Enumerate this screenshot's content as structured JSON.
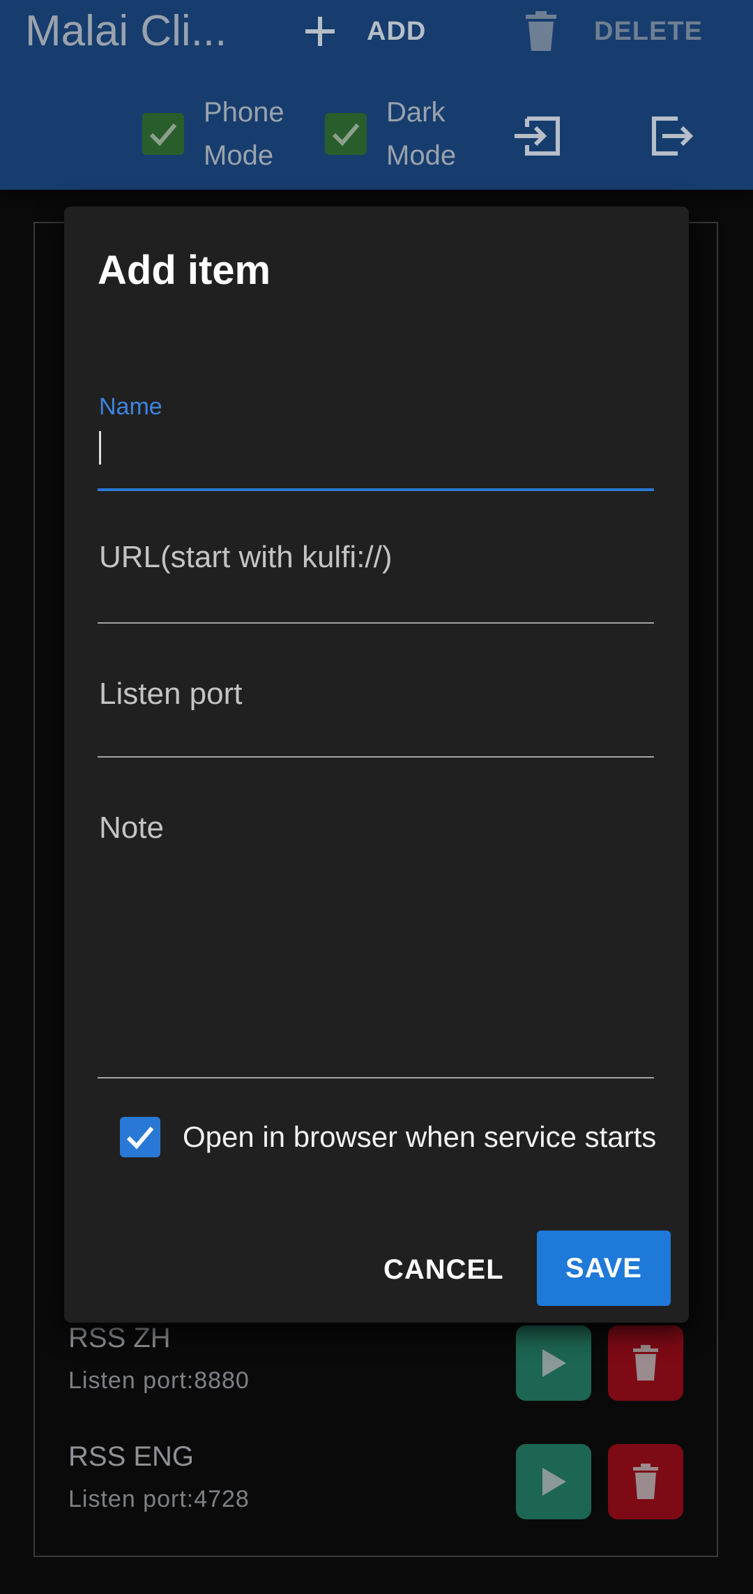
{
  "appbar": {
    "title": "Malai Cli...",
    "add_label": "ADD",
    "delete_label": "DELETE",
    "phone_mode_label": "Phone Mode",
    "dark_mode_label": "Dark Mode",
    "phone_mode_checked": true,
    "dark_mode_checked": true
  },
  "list": {
    "items": [
      {
        "name": "RSS ZH",
        "port": "Listen port:8880"
      },
      {
        "name": "RSS ENG",
        "port": "Listen port:4728"
      }
    ]
  },
  "dialog": {
    "title": "Add item",
    "name_label": "Name",
    "name_value": "",
    "url_placeholder": "URL(start with kulfi://)",
    "port_placeholder": "Listen port",
    "note_placeholder": "Note",
    "open_browser_label": "Open in browser when service starts",
    "open_browser_checked": true,
    "cancel_label": "CANCEL",
    "save_label": "SAVE"
  },
  "colors": {
    "appbar": "#173d6e",
    "accent": "#1f79d8",
    "play": "#1d6653",
    "delete": "#7e0a15"
  }
}
